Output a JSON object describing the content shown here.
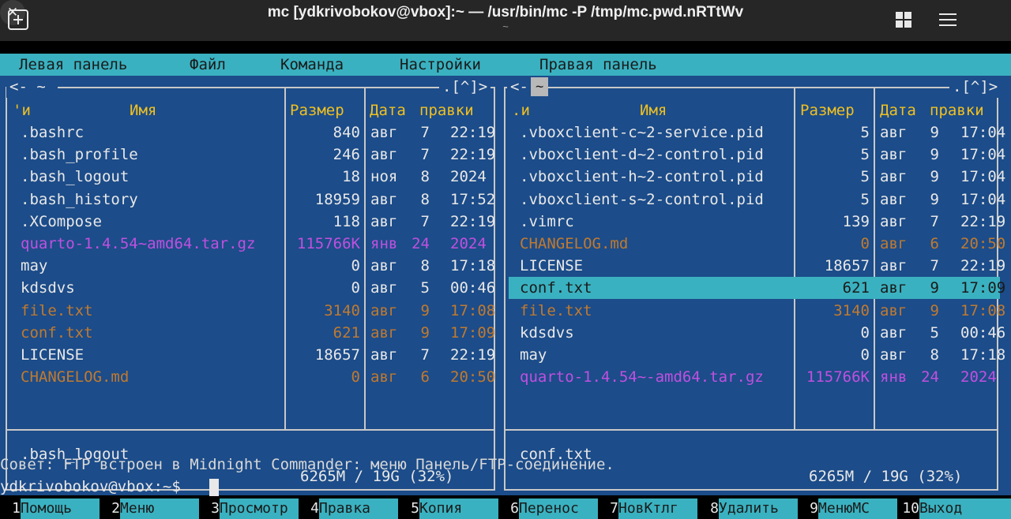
{
  "window": {
    "title": "mc [ydkrivobokov@vbox]:~ — /usr/bin/mc -P /tmp/mc.pwd.nRTtWv",
    "subtitle": "~"
  },
  "menubar": [
    "Левая панель",
    "Файл",
    "Команда",
    "Настройки",
    "Правая панель"
  ],
  "left_panel": {
    "path": "~",
    "corner": ".[^]>",
    "headers": {
      "marker": "'и",
      "name": "Имя",
      "size": "Размер",
      "date": "Дата",
      "modified": "правки"
    },
    "files": [
      {
        "name": ".bashrc",
        "size": "840",
        "month": "авг",
        "day": "7",
        "time": "22:19",
        "type": "normal"
      },
      {
        "name": ".bash_profile",
        "size": "246",
        "month": "авг",
        "day": "7",
        "time": "22:19",
        "type": "normal"
      },
      {
        "name": ".bash_logout",
        "size": "18",
        "month": "ноя",
        "day": "8",
        "time": "2024",
        "type": "normal"
      },
      {
        "name": ".bash_history",
        "size": "18959",
        "month": "авг",
        "day": "8",
        "time": "17:52",
        "type": "normal"
      },
      {
        "name": ".XCompose",
        "size": "118",
        "month": "авг",
        "day": "7",
        "time": "22:19",
        "type": "normal"
      },
      {
        "name": "quarto-1.4.54~amd64.tar.gz",
        "size": "115766K",
        "month": "янв",
        "day": "24",
        "time": "2024",
        "type": "archive"
      },
      {
        "name": "may",
        "size": "0",
        "month": "авг",
        "day": "8",
        "time": "17:18",
        "type": "normal"
      },
      {
        "name": "kdsdvs",
        "size": "0",
        "month": "авг",
        "day": "5",
        "time": "00:46",
        "type": "normal"
      },
      {
        "name": "file.txt",
        "size": "3140",
        "month": "авг",
        "day": "9",
        "time": "17:08",
        "type": "marked"
      },
      {
        "name": "conf.txt",
        "size": "621",
        "month": "авг",
        "day": "9",
        "time": "17:09",
        "type": "marked"
      },
      {
        "name": "LICENSE",
        "size": "18657",
        "month": "авг",
        "day": "7",
        "time": "22:19",
        "type": "normal"
      },
      {
        "name": "CHANGELOG.md",
        "size": "0",
        "month": "авг",
        "day": "6",
        "time": "20:50",
        "type": "marked"
      }
    ],
    "status": ".bash_logout",
    "disk": "6265M / 19G (32%)"
  },
  "right_panel": {
    "path": "~",
    "corner": ".[^]>",
    "headers": {
      "marker": ".и",
      "name": "Имя",
      "size": "Размер",
      "date": "Дата",
      "modified": "правки"
    },
    "files": [
      {
        "name": ".vboxclient-c~2-service.pid",
        "size": "5",
        "month": "авг",
        "day": "9",
        "time": "17:04",
        "type": "normal"
      },
      {
        "name": ".vboxclient-d~2-control.pid",
        "size": "5",
        "month": "авг",
        "day": "9",
        "time": "17:04",
        "type": "normal"
      },
      {
        "name": ".vboxclient-h~2-control.pid",
        "size": "5",
        "month": "авг",
        "day": "9",
        "time": "17:04",
        "type": "normal"
      },
      {
        "name": ".vboxclient-s~2-control.pid",
        "size": "5",
        "month": "авг",
        "day": "9",
        "time": "17:04",
        "type": "normal"
      },
      {
        "name": ".vimrc",
        "size": "139",
        "month": "авг",
        "day": "7",
        "time": "22:19",
        "type": "normal"
      },
      {
        "name": "CHANGELOG.md",
        "size": "0",
        "month": "авг",
        "day": "6",
        "time": "20:50",
        "type": "marked"
      },
      {
        "name": "LICENSE",
        "size": "18657",
        "month": "авг",
        "day": "7",
        "time": "22:19",
        "type": "normal"
      },
      {
        "name": "conf.txt",
        "size": "621",
        "month": "авг",
        "day": "9",
        "time": "17:09",
        "type": "selected"
      },
      {
        "name": "file.txt",
        "size": "3140",
        "month": "авг",
        "day": "9",
        "time": "17:08",
        "type": "marked"
      },
      {
        "name": "kdsdvs",
        "size": "0",
        "month": "авг",
        "day": "5",
        "time": "00:46",
        "type": "normal"
      },
      {
        "name": "may",
        "size": "0",
        "month": "авг",
        "day": "8",
        "time": "17:18",
        "type": "normal"
      },
      {
        "name": "quarto-1.4.54~-amd64.tar.gz",
        "size": "115766K",
        "month": "янв",
        "day": "24",
        "time": "2024",
        "type": "archive"
      }
    ],
    "status": "conf.txt",
    "disk": "6265M / 19G (32%)"
  },
  "hint": "Совет: FTP встроен в Midnight Commander: меню Панель/FTP-соединение.",
  "prompt": "ydkrivobokov@vbox:~$ ",
  "fkeys": [
    {
      "num": "1",
      "label": "Помощь"
    },
    {
      "num": "2",
      "label": "Меню"
    },
    {
      "num": "3",
      "label": "Просмотр"
    },
    {
      "num": "4",
      "label": "Правка"
    },
    {
      "num": "5",
      "label": "Копия"
    },
    {
      "num": "6",
      "label": "Перенос"
    },
    {
      "num": "7",
      "label": "НовКтлг"
    },
    {
      "num": "8",
      "label": "Удалить"
    },
    {
      "num": "9",
      "label": "МенюMC"
    },
    {
      "num": "10",
      "label": "Выход"
    }
  ],
  "colors": {
    "panel_bg": "#1c4c89",
    "accent_cyan": "#3ab1c0",
    "header_yellow": "#f0c020",
    "archive_magenta": "#c050e0",
    "marked_brown": "#c07a30"
  }
}
